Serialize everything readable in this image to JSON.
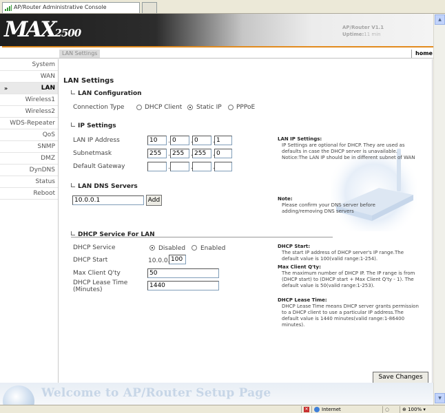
{
  "window": {
    "tab_title": "AP/Router Administrative Console"
  },
  "header": {
    "logo_main": "MAX",
    "logo_num": "2500",
    "version": "AP/Router V1.1",
    "uptime_label": "Uptime:",
    "uptime_value": "11 min"
  },
  "nav": {
    "current_tab": "LAN Settings",
    "home": "home"
  },
  "sidebar": {
    "items": [
      {
        "label": "System"
      },
      {
        "label": "WAN"
      },
      {
        "label": "LAN"
      },
      {
        "label": "Wireless1"
      },
      {
        "label": "Wireless2"
      },
      {
        "label": "WDS-Repeater"
      },
      {
        "label": "QoS"
      },
      {
        "label": "SNMP"
      },
      {
        "label": "DMZ"
      },
      {
        "label": "DynDNS"
      },
      {
        "label": "Status"
      },
      {
        "label": "Reboot"
      }
    ],
    "pointer": "»",
    "active_index": 2
  },
  "page": {
    "title": "LAN Settings",
    "lan_config": {
      "heading": "LAN Configuration",
      "connection_type_label": "Connection Type",
      "options": [
        "DHCP Client",
        "Static IP",
        "PPPoE"
      ],
      "selected": "Static IP"
    },
    "ip_settings": {
      "heading": "IP Settings",
      "ip_label": "LAN IP Address",
      "ip": [
        "10",
        "0",
        "0",
        "1"
      ],
      "mask_label": "Subnetmask",
      "mask": [
        "255",
        "255",
        "255",
        "0"
      ],
      "gateway_label": "Default Gateway",
      "gateway": [
        "",
        "",
        "",
        ""
      ],
      "dot": "."
    },
    "dns": {
      "heading": "LAN DNS Servers",
      "value": "10.0.0.1",
      "add_label": "Add"
    },
    "dhcp": {
      "heading": "DHCP Service For LAN",
      "service_label": "DHCP Service",
      "options": [
        "Disabled",
        "Enabled"
      ],
      "selected": "Disabled",
      "start_label": "DHCP Start",
      "start_prefix": "10.0.0.",
      "start_value": "100",
      "max_label": "Max Client Q'ty",
      "max_value": "50",
      "lease_label_1": "DHCP Lease Time",
      "lease_label_2": "(Minutes)",
      "lease_value": "1440"
    },
    "save_label": "Save Changes"
  },
  "notes": {
    "ip_title": "LAN IP Settings:",
    "ip_text": "IP Settings are optional for DHCP. They are used as defaults in case the DHCP server is unavailable. Notice:The LAN IP should be in different subnet of WAN",
    "dns_title": "Note:",
    "dns_text": "Please confirm your DNS server before adding/removing DNS servers",
    "start_title": "DHCP Start:",
    "start_text": "The start IP address of DHCP server's IP range.The default value is 100(valid range:1-254).",
    "max_title": "Max Client Q'ty:",
    "max_text": "The maximum number of DHCP IP. The IP range is from (DHCP start) to (DHCP start + Max Client Q'ty - 1). The default value is 50(valid range:1-253).",
    "lease_title": "DHCP Lease Time:",
    "lease_text": "DHCP Lease Time means DHCP server grants permission to a DHCP client to use a particular IP address.The default value is 1440 minutes(valid range:1-86400 minutes)."
  },
  "footer": {
    "welcome": "Welcome to AP/Router Setup Page"
  },
  "statusbar": {
    "zone": "Internet",
    "zoom": "100%"
  }
}
